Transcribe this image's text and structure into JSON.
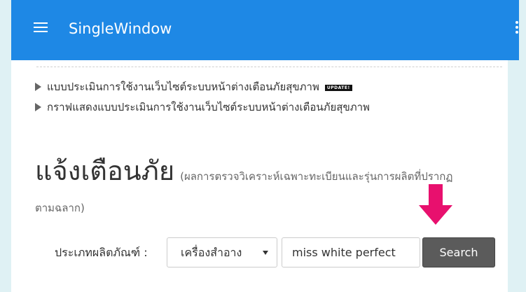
{
  "colors": {
    "appbar": "#1e88e5",
    "frame": "#dff1f4",
    "arrow": "#e8106e",
    "search_button": "#5b5b5b"
  },
  "appbar": {
    "title": "SingleWindow",
    "menu_icon": "hamburger-menu-icon",
    "more_icon": "more-vert-icon"
  },
  "links": [
    {
      "label": "แบบประเมินการใช้งานเว็บไซต์ระบบหน้าต่างเตือนภัยสุขภาพ",
      "badge": "UPDATE!"
    },
    {
      "label": "กราฟแสดงแบบประเมินการใช้งานเว็บไซต์ระบบหน้าต่างเตือนภัยสุขภาพ"
    }
  ],
  "heading": {
    "title": "แจ้งเตือนภัย",
    "subtitle_part1": "(ผลการตรวจวิเคราะห์เฉพาะทะเบียนและรุ่นการผลิตที่ปรากฏ",
    "subtitle_part2": "ตามฉลาก)"
  },
  "search": {
    "category_label": "ประเภทผลิตภัณฑ์ :",
    "category_value": "เครื่องสำอาง",
    "query": "miss white perfect",
    "button_label": "Search"
  }
}
